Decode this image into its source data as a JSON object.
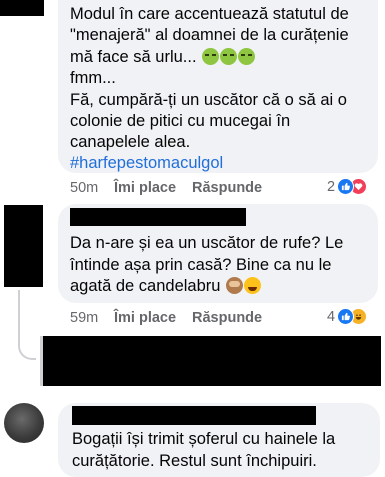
{
  "comments": [
    {
      "lines": [
        "Modul în care accentuează statutul de",
        "\"menajeră\" al doamnei de la curățenie",
        "mă face să urlu...",
        "fmm...",
        "Fă, cumpără-ți un uscător că o să ai o",
        "colonie de pitici cu mucegai în",
        "canapelele alea."
      ],
      "line3_emojis": [
        "sick-face-emoji",
        "sick-face-emoji",
        "sick-face-emoji"
      ],
      "hashtag": "#harfepestomaculgol",
      "time": "50m",
      "like_label": "Îmi place",
      "reply_label": "Răspunde",
      "reaction_count": "2",
      "reactions": [
        "like-reaction-icon",
        "heart-reaction-icon"
      ]
    },
    {
      "lines": [
        "Da n-are și ea un uscător de rufe? Le",
        "întinde așa prin casă? Bine ca nu le",
        "agată de candelabru"
      ],
      "line3_emojis": [
        "see-no-evil-monkey-emoji",
        "laughing-face-emoji"
      ],
      "time": "59m",
      "like_label": "Îmi place",
      "reply_label": "Răspunde",
      "reaction_count": "4",
      "reactions": [
        "like-reaction-icon",
        "haha-reaction-icon"
      ]
    },
    {
      "lines": [
        "Bogații își trimit șoferul cu hainele la",
        "curățătorie. Restul sunt închipuiri."
      ]
    }
  ],
  "colors": {
    "bubble": "#f0f2f5",
    "text": "#050505",
    "meta": "#65676b",
    "hashtag": "#216fdb",
    "like_blue": "#1877f2",
    "heart_red": "#f33e58",
    "haha_yellow": "#f7b125"
  }
}
